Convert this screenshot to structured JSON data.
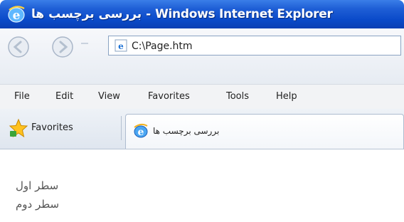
{
  "window": {
    "title": "بررسی برچسب ها - Windows Internet Explorer"
  },
  "address_bar": {
    "url": "C:\\Page.htm"
  },
  "menu": {
    "items": [
      "File",
      "Edit",
      "View",
      "Favorites",
      "Tools",
      "Help"
    ]
  },
  "favorites_bar": {
    "favorites_label": "Favorites",
    "tab_title": "بررسی برچسب ها"
  },
  "page": {
    "lines": [
      "سطر اول",
      "سطر دوم"
    ]
  },
  "icons": {
    "title": "ie-logo-icon",
    "back": "back-arrow-icon",
    "forward": "forward-arrow-icon",
    "address": "ie-page-icon",
    "favorites": "favorites-star-icon",
    "tab": "ie-tab-icon"
  },
  "colors": {
    "titlebar": "#0a4ac9",
    "title_text": "#ffffff",
    "toolbar": "#e6ebf2",
    "content_text": "#555555"
  }
}
